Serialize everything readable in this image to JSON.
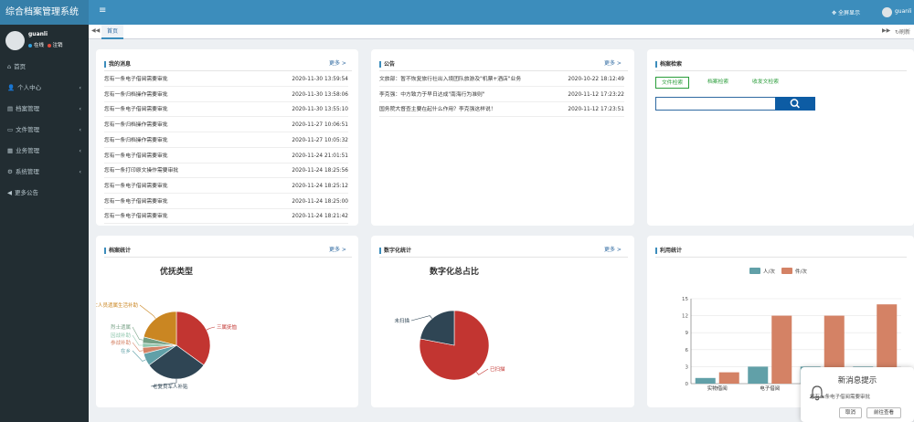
{
  "app": {
    "title": "综合档案管理系统",
    "fullscreen_label": "全屏显示",
    "user": "guanli"
  },
  "sidebar": {
    "username": "guanli",
    "online_label": "在线",
    "logout_label": "注销",
    "items": [
      {
        "icon": "home-icon",
        "glyph": "⌂",
        "label": "首页",
        "has_children": false
      },
      {
        "icon": "user-icon",
        "glyph": "👤",
        "label": "个人中心",
        "has_children": true
      },
      {
        "icon": "archive-icon",
        "glyph": "▤",
        "label": "档案管理",
        "has_children": true
      },
      {
        "icon": "file-icon",
        "glyph": "▭",
        "label": "文件管理",
        "has_children": true
      },
      {
        "icon": "business-icon",
        "glyph": "▦",
        "label": "业务管理",
        "has_children": true
      },
      {
        "icon": "gear-icon",
        "glyph": "⚙",
        "label": "系统管理",
        "has_children": true
      },
      {
        "icon": "megaphone-icon",
        "glyph": "◀",
        "label": "更多公告",
        "has_children": false
      }
    ]
  },
  "tabs": {
    "home": "首页",
    "refresh": "刷新"
  },
  "messages": {
    "title": "我的消息",
    "more": "更多 >",
    "rows": [
      {
        "text": "您有一条电子借阅需要审批",
        "date": "2020-11-30 13:59:54"
      },
      {
        "text": "您有一条归档操作需要审批",
        "date": "2020-11-30 13:58:06"
      },
      {
        "text": "您有一条电子借阅需要审批",
        "date": "2020-11-30 13:55:10"
      },
      {
        "text": "您有一条归档操作需要审批",
        "date": "2020-11-27 10:06:51"
      },
      {
        "text": "您有一条归档操作需要审批",
        "date": "2020-11-27 10:05:32"
      },
      {
        "text": "您有一条电子借阅需要审批",
        "date": "2020-11-24 21:01:51"
      },
      {
        "text": "您有一条打印原文操作需要审批",
        "date": "2020-11-24 18:25:56"
      },
      {
        "text": "您有一条电子借阅需要审批",
        "date": "2020-11-24 18:25:12"
      },
      {
        "text": "您有一条电子借阅需要审批",
        "date": "2020-11-24 18:25:00"
      },
      {
        "text": "您有一条电子借阅需要审批",
        "date": "2020-11-24 18:21:42"
      }
    ]
  },
  "announcements": {
    "title": "公告",
    "more": "更多 >",
    "rows": [
      {
        "text": "文旅部：暂不恢复旅行社出入境团队旅游及\"机票+酒店\"业务",
        "date": "2020-10-22 18:12:49"
      },
      {
        "text": "李克强：中方致力于早日达成\"南海行为准则\"",
        "date": "2020-11-12 17:23:22"
      },
      {
        "text": "国务院大督查主要在起什么作用？李克强这样说！",
        "date": "2020-11-12 17:23:51"
      }
    ]
  },
  "search": {
    "title": "档案检索",
    "tabs": [
      "文件检索",
      "档案检索",
      "收发文检索"
    ],
    "active_tab": 0,
    "accent": "#0d5ca4"
  },
  "stat_panels": {
    "archive": {
      "title": "档案统计",
      "more": "更多 >"
    },
    "digital": {
      "title": "数字化统计",
      "more": "更多 >"
    },
    "usage": {
      "title": "利用统计"
    }
  },
  "chart_data": [
    {
      "type": "pie",
      "title": "优抚类型",
      "slices": [
        {
          "label": "三属抚恤",
          "value": 35,
          "color": "#c23531"
        },
        {
          "label": "老复员军人补贴",
          "value": 30,
          "color": "#2f4554"
        },
        {
          "label": "在乡",
          "value": 6,
          "color": "#61a0a8"
        },
        {
          "label": "参战补助",
          "value": 3,
          "color": "#d48265"
        },
        {
          "label": "因战补助",
          "value": 2,
          "color": "#91c7ae"
        },
        {
          "label": "烈士遗属",
          "value": 3,
          "color": "#749f83"
        },
        {
          "label": "因公亡人员遗属生活补助",
          "value": 21,
          "color": "#ca8622"
        }
      ]
    },
    {
      "type": "pie",
      "title": "数字化总占比",
      "slices": [
        {
          "label": "已扫描",
          "value": 78,
          "color": "#c23531"
        },
        {
          "label": "未扫描",
          "value": 22,
          "color": "#2f4554"
        }
      ]
    },
    {
      "type": "bar",
      "title": "",
      "categories": [
        "实物借阅",
        "电子借阅",
        "",
        ""
      ],
      "series": [
        {
          "name": "人/次",
          "values": [
            1,
            3,
            3,
            3
          ],
          "color": "#61a0a8"
        },
        {
          "name": "件/次",
          "values": [
            2,
            12,
            12,
            14
          ],
          "color": "#d48265"
        }
      ],
      "ylim": [
        0,
        15
      ],
      "yticks": [
        0,
        3,
        6,
        9,
        12,
        15
      ],
      "legend": "top"
    }
  ],
  "notification": {
    "title": "新消息提示",
    "message": "您有一条电子借阅需要审批",
    "cancel": "取消",
    "go": "前往查看"
  }
}
